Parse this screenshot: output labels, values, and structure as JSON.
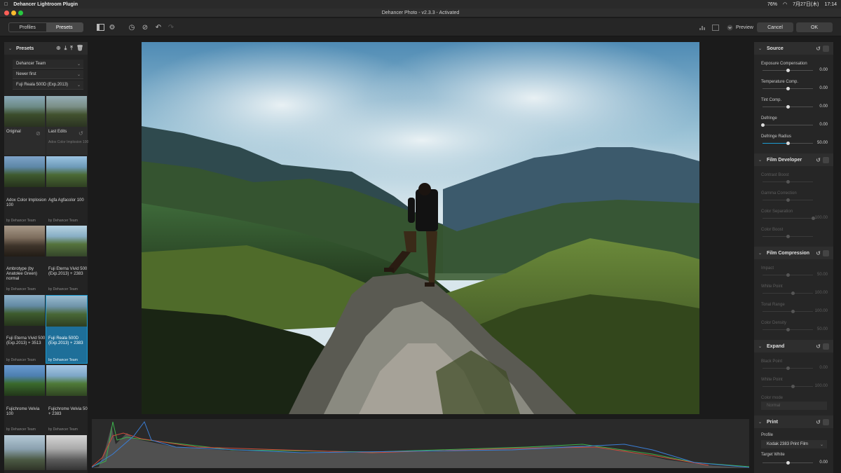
{
  "menubar": {
    "app": "Dehancer Lightroom Plugin",
    "battery": "76%",
    "datetime": "7月27日(木)",
    "clock": "17:14"
  },
  "window": {
    "title": "Dehancer Photo - v2.3.3 - Activated"
  },
  "toolbar": {
    "tab_profiles": "Profiles",
    "tab_presets": "Presets",
    "preview_label": "Preview",
    "cancel_label": "Cancel",
    "ok_label": "OK"
  },
  "presets": {
    "header": "Presets",
    "author_filter": "Dehancer Team",
    "sort": "Newer first",
    "selected": "Fuji Reala 500D (Exp.2013)",
    "items": [
      {
        "label": "Original",
        "by": ""
      },
      {
        "label": "Last Edits",
        "by": "Adox Color Implosion 100"
      },
      {
        "label": "Adox Color Implosion 100",
        "by": "by Dehancer Team"
      },
      {
        "label": "Agfa Agfacolor 100",
        "by": "by Dehancer Team"
      },
      {
        "label": "Ambrotype (by Anatolee Green) normal",
        "by": "by Dehancer Team"
      },
      {
        "label": "Fuji Eterna Vivid 500 (Exp.2013) + 2383",
        "by": "by Dehancer Team"
      },
      {
        "label": "Fuji Eterna Vivid 500 (Exp.2013) + 3513",
        "by": "by Dehancer Team"
      },
      {
        "label": "Fuji Reala 500D (Exp.2013) + 2383",
        "by": "by Dehancer Team"
      },
      {
        "label": "Fujichrome Velvia 100",
        "by": "by Dehancer Team"
      },
      {
        "label": "Fujichrome Velvia 50 + 2383",
        "by": "by Dehancer Team"
      }
    ]
  },
  "sections": {
    "source": {
      "title": "Source",
      "params": [
        {
          "label": "Exposure Compensation",
          "value": "0.00",
          "pos": 0.5
        },
        {
          "label": "Temperature Comp.",
          "value": "0.00",
          "pos": 0.5
        },
        {
          "label": "Tint Comp.",
          "value": "0.00",
          "pos": 0.5
        },
        {
          "label": "Defringe",
          "value": "0.00",
          "pos": 0.0
        },
        {
          "label": "Defringe Radius",
          "value": "50.00",
          "pos": 0.5
        }
      ]
    },
    "film_developer": {
      "title": "Film Developer",
      "params": [
        {
          "label": "Contrast Boost",
          "value": "",
          "pos": 0.5
        },
        {
          "label": "Gamma Correction",
          "value": "",
          "pos": 0.5
        },
        {
          "label": "Color Separation",
          "value": "100.00",
          "pos": 1.0
        },
        {
          "label": "Color Boost",
          "value": "",
          "pos": 0.5
        }
      ]
    },
    "film_compression": {
      "title": "Film Compression",
      "params": [
        {
          "label": "Impact",
          "value": "50.00",
          "pos": 0.5
        },
        {
          "label": "White Point",
          "value": "100.00",
          "pos": 0.6
        },
        {
          "label": "Tonal Range",
          "value": "100.00",
          "pos": 0.6
        },
        {
          "label": "Color Density",
          "value": "50.00",
          "pos": 0.5
        }
      ]
    },
    "expand": {
      "title": "Expand",
      "params": [
        {
          "label": "Black Point",
          "value": "0.00",
          "pos": 0.5
        },
        {
          "label": "White Point",
          "value": "100.00",
          "pos": 0.6
        }
      ],
      "color_mode_label": "Color mode",
      "color_mode": "Normal"
    },
    "print": {
      "title": "Print",
      "profile_label": "Profile",
      "profile": "Kodak 2383 Print Film",
      "target_white_label": "Target White",
      "target_white": "0.00",
      "target_white_pos": 0.5
    }
  },
  "colors": {
    "accent": "#1d9bd1",
    "panel": "#262626",
    "selected": "#1e6f99"
  }
}
